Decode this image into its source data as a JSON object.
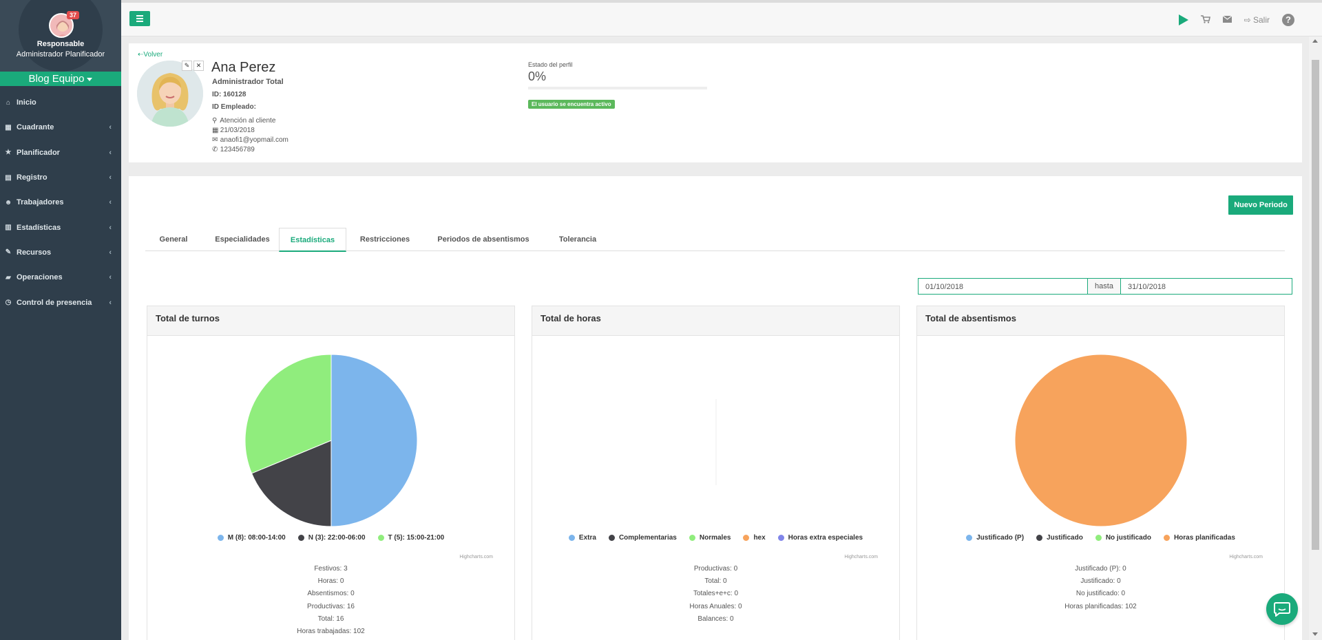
{
  "sidebar": {
    "badge": "37",
    "role": "Responsable",
    "subrole": "Administrador Planificador",
    "team": "Blog Equipo",
    "items": [
      {
        "label": "Inicio",
        "icon": "home-icon"
      },
      {
        "label": "Cuadrante",
        "icon": "calendar-icon"
      },
      {
        "label": "Planificador",
        "icon": "star-icon"
      },
      {
        "label": "Registro",
        "icon": "file-icon"
      },
      {
        "label": "Trabajadores",
        "icon": "users-icon"
      },
      {
        "label": "Estadísticas",
        "icon": "bar-chart-icon"
      },
      {
        "label": "Recursos",
        "icon": "wrench-icon"
      },
      {
        "label": "Operaciones",
        "icon": "area-chart-icon"
      },
      {
        "label": "Control de presencia",
        "icon": "clock-icon"
      }
    ]
  },
  "topbar": {
    "logout_label": "Salir",
    "help_label": "?"
  },
  "profile": {
    "back_label": "Volver",
    "name": "Ana Perez",
    "role": "Administrador Total",
    "id_text": "ID: 160128",
    "employee_id_text": "ID Empleado:",
    "department": "Atención al cliente",
    "date": "21/03/2018",
    "email": "anaofi1@yopmail.com",
    "phone": "123456789",
    "status_label": "Estado del perfil",
    "status_percent": "0%",
    "status_progress": 0,
    "active_badge": "El usuario se encuentra activo"
  },
  "main": {
    "new_period_label": "Nuevo Periodo",
    "tabs": [
      {
        "label": "General"
      },
      {
        "label": "Especialidades"
      },
      {
        "label": "Estadísticas"
      },
      {
        "label": "Restricciones"
      },
      {
        "label": "Periodos de absentismos"
      },
      {
        "label": "Tolerancia"
      }
    ],
    "date_from": "01/10/2018",
    "date_sep": "hasta",
    "date_to": "31/10/2018"
  },
  "cards": {
    "turnos": {
      "title": "Total de turnos",
      "credit": "Highcharts.com",
      "stats": [
        "Festivos: 3",
        "Horas: 0",
        "Absentismos: 0",
        "Productivas: 16",
        "Total: 16",
        "Horas trabajadas: 102"
      ]
    },
    "horas": {
      "title": "Total de horas",
      "credit": "Highcharts.com",
      "stats": [
        "Productivas: 0",
        "Total: 0",
        "Totales+e+c: 0",
        "Horas Anuales: 0",
        "Balances: 0"
      ]
    },
    "absentismos": {
      "title": "Total de absentismos",
      "credit": "Highcharts.com",
      "stats": [
        "Justificado (P): 0",
        "Justificado: 0",
        "No justificado: 0",
        "Horas planificadas: 102"
      ]
    }
  },
  "chart_data": [
    {
      "type": "pie",
      "title": "Total de turnos",
      "series": [
        {
          "name": "M (8): 08:00-14:00",
          "value": 8,
          "color": "#7cb5ec"
        },
        {
          "name": "N (3): 22:00-06:00",
          "value": 3,
          "color": "#434348"
        },
        {
          "name": "T (5): 15:00-21:00",
          "value": 5,
          "color": "#90ed7d"
        }
      ]
    },
    {
      "type": "pie",
      "title": "Total de horas",
      "series": [
        {
          "name": "Extra",
          "value": 0,
          "color": "#7cb5ec"
        },
        {
          "name": "Complementarias",
          "value": 0,
          "color": "#434348"
        },
        {
          "name": "Normales",
          "value": 0,
          "color": "#90ed7d"
        },
        {
          "name": "hex",
          "value": 0,
          "color": "#f7a35c"
        },
        {
          "name": "Horas extra especiales",
          "value": 0,
          "color": "#8085e9"
        }
      ]
    },
    {
      "type": "pie",
      "title": "Total de absentismos",
      "series": [
        {
          "name": "Justificado (P)",
          "value": 0,
          "color": "#7cb5ec"
        },
        {
          "name": "Justificado",
          "value": 0,
          "color": "#434348"
        },
        {
          "name": "No justificado",
          "value": 0,
          "color": "#90ed7d"
        },
        {
          "name": "Horas planificadas",
          "value": 102,
          "color": "#f7a35c"
        }
      ]
    }
  ]
}
